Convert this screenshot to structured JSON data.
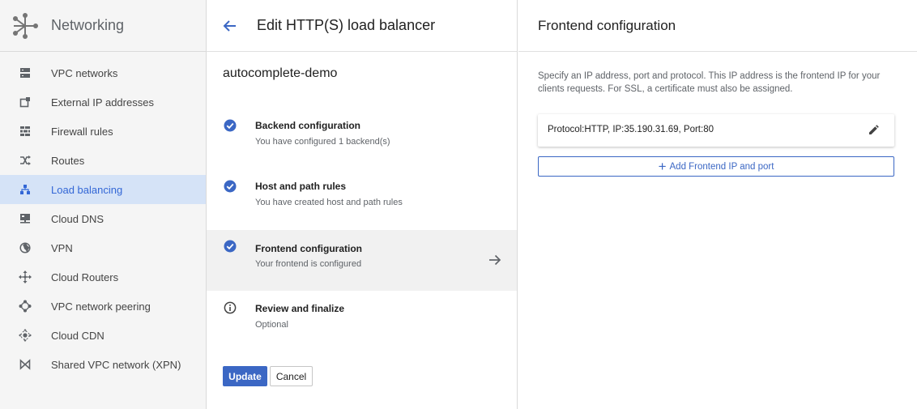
{
  "sidebar": {
    "title": "Networking",
    "items": [
      {
        "label": "VPC networks",
        "icon": "vpc-networks-icon"
      },
      {
        "label": "External IP addresses",
        "icon": "external-ip-icon"
      },
      {
        "label": "Firewall rules",
        "icon": "firewall-icon"
      },
      {
        "label": "Routes",
        "icon": "routes-icon"
      },
      {
        "label": "Load balancing",
        "icon": "load-balancing-icon",
        "active": true
      },
      {
        "label": "Cloud DNS",
        "icon": "cloud-dns-icon"
      },
      {
        "label": "VPN",
        "icon": "vpn-icon"
      },
      {
        "label": "Cloud Routers",
        "icon": "cloud-routers-icon"
      },
      {
        "label": "VPC network peering",
        "icon": "vpc-peering-icon"
      },
      {
        "label": "Cloud CDN",
        "icon": "cloud-cdn-icon"
      },
      {
        "label": "Shared VPC network (XPN)",
        "icon": "shared-vpc-icon"
      }
    ]
  },
  "editor": {
    "title": "Edit HTTP(S) load balancer",
    "lb_name": "autocomplete-demo",
    "steps": [
      {
        "title": "Backend configuration",
        "subtitle": "You have configured 1 backend(s)",
        "status": "complete"
      },
      {
        "title": "Host and path rules",
        "subtitle": "You have created host and path rules",
        "status": "complete"
      },
      {
        "title": "Frontend configuration",
        "subtitle": "Your frontend is configured",
        "status": "complete",
        "active": true
      },
      {
        "title": "Review and finalize",
        "subtitle": "Optional",
        "status": "info"
      }
    ],
    "update_label": "Update",
    "cancel_label": "Cancel"
  },
  "frontend": {
    "title": "Frontend configuration",
    "description": "Specify an IP address, port and protocol. This IP address is the frontend IP for your clients requests. For SSL, a certificate must also be assigned.",
    "entry": "Protocol:HTTP, IP:35.190.31.69, Port:80",
    "add_label": "Add Frontend IP and port"
  },
  "colors": {
    "accent": "#3b67c4",
    "active_nav_bg": "#d5e3f7",
    "sidebar_bg": "#f5f5f5"
  }
}
